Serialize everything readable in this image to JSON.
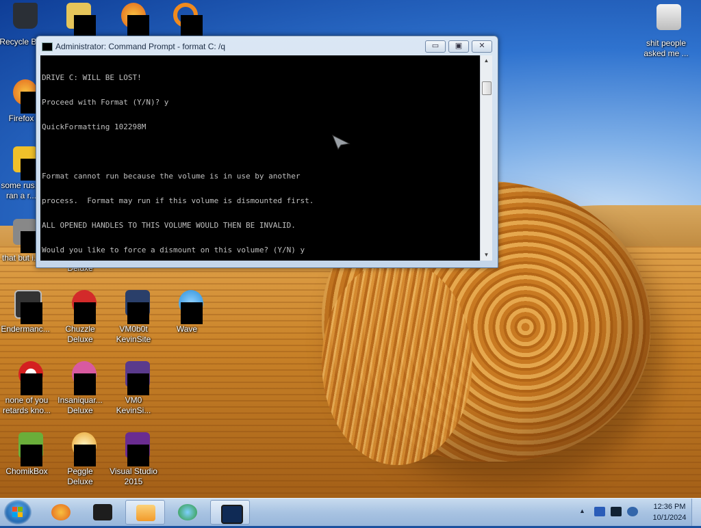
{
  "desktop": {
    "icons": [
      {
        "id": "recycle-bin",
        "label": "Recycle Bin",
        "color": "#2a2f36"
      },
      {
        "id": "folder-1",
        "label": "",
        "color": "#e6c55a"
      },
      {
        "id": "firefox-top",
        "label": "",
        "color": "#e2631c"
      },
      {
        "id": "orange-ring",
        "label": "",
        "color": "#f08a1e"
      },
      {
        "id": "firefox-left",
        "label": "Firefox",
        "color": "#e2631c"
      },
      {
        "id": "some-rus",
        "label": "some rus... ran a r...",
        "color": "#f0c02a"
      },
      {
        "id": "that-but",
        "label": "that but i...",
        "color": "#888888"
      },
      {
        "id": "deluxe-hidden",
        "label": "Deluxe",
        "color": "#000000"
      },
      {
        "id": "endermanch",
        "label": "Endermanc...",
        "color": "#333333"
      },
      {
        "id": "chuzzle",
        "label": "Chuzzle Deluxe",
        "color": "#d32a2a"
      },
      {
        "id": "vm0b0t-kevinsite",
        "label": "VM0b0t KevinSite",
        "color": "#2a3f6a"
      },
      {
        "id": "wave",
        "label": "Wave",
        "color": "#2b8fd9"
      },
      {
        "id": "none-of-you",
        "label": "none of you retards kno...",
        "color": "#d42020"
      },
      {
        "id": "insaniquarium",
        "label": "Insaniquar... Deluxe",
        "color": "#d85aa0"
      },
      {
        "id": "vm0-kevinsi",
        "label": "VM0 KevinSi...",
        "color": "#5a3a8c"
      },
      {
        "id": "chomikbox",
        "label": "ChomikBox",
        "color": "#6aae3a"
      },
      {
        "id": "peggle",
        "label": "Peggle Deluxe",
        "color": "#e8a32c"
      },
      {
        "id": "visual-studio",
        "label": "Visual Studio 2015",
        "color": "#6a2c91"
      },
      {
        "id": "shit-people",
        "label": "shit people asked me ...",
        "color": "#e8e8e8"
      }
    ]
  },
  "cmd": {
    "title": "Administrator: Command Prompt - format  C: /q",
    "buttons": {
      "minimize": "▭",
      "maximize": "▣",
      "close": "✕"
    },
    "lines": [
      "DRIVE C: WILL BE LOST!",
      "Proceed with Format (Y/N)? y",
      "QuickFormatting 102298M",
      "",
      "Format cannot run because the volume is in use by another",
      "process.  Format may run if this volume is dismounted first.",
      "ALL OPENED HANDLES TO THIS VOLUME WOULD THEN BE INVALID.",
      "Would you like to force a dismount on this volume? (Y/N) y"
    ],
    "scroll_up": "▲",
    "scroll_down": "▼"
  },
  "taskbar": {
    "items": [
      {
        "id": "firefox",
        "color": "#e2631c",
        "active": false
      },
      {
        "id": "app-dark",
        "color": "#1d1d1d",
        "active": false
      },
      {
        "id": "media-player",
        "color": "#f29a2a",
        "active": true
      },
      {
        "id": "internet-download",
        "color": "#2f9a3a",
        "active": false
      },
      {
        "id": "cmd",
        "color": "#0f2a55",
        "active": true
      }
    ],
    "tray": {
      "arrow": "▲",
      "time": "12:36 PM",
      "date": "10/1/2024"
    }
  }
}
